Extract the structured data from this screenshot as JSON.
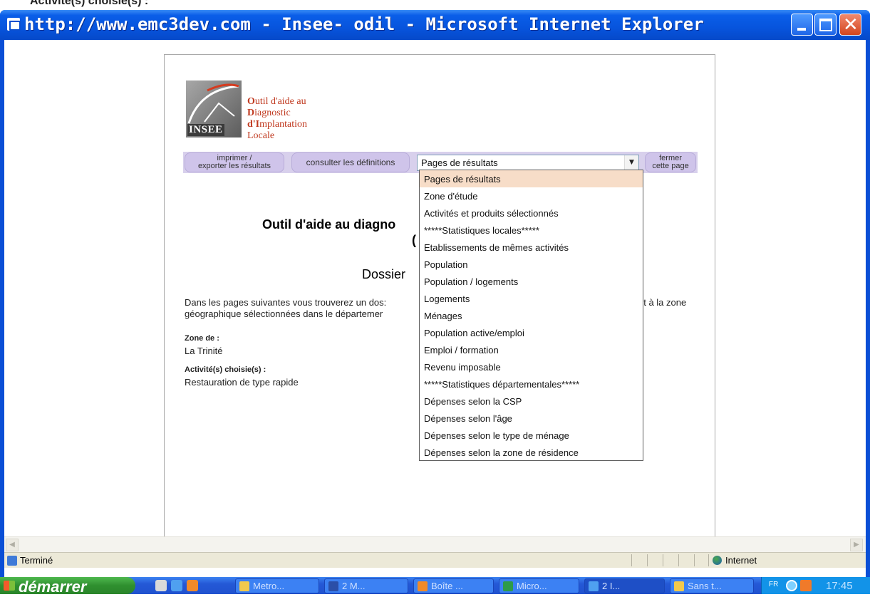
{
  "clipped_top_text": "Activité(s) choisie(s) :",
  "window": {
    "title": "http://www.emc3dev.com - Insee- odil - Microsoft Internet Explorer"
  },
  "logo": {
    "insee": "INSEE",
    "lines": [
      {
        "initial": "O",
        "rest": "util d'aide au"
      },
      {
        "initial": "D",
        "rest": "iagnostic"
      },
      {
        "initial": "d'I",
        "rest": "mplantation"
      },
      {
        "initial": "",
        "rest": "Locale"
      }
    ]
  },
  "toolbar": {
    "print_line1": "imprimer /",
    "print_line2": "exporter les résultats",
    "definitions": "consulter les définitions",
    "select_value": "Pages de résultats",
    "close_line1": "fermer",
    "close_line2": "cette page"
  },
  "content": {
    "title_part": "Outil d'aide au diagno",
    "title_part2": "(",
    "dossier": "Dossier",
    "intro_line1": "Dans les pages suivantes vous trouverez un dos:",
    "intro_line1_end": "et à la zone",
    "intro_line2": "géographique sélectionnées dans le départemer",
    "zone_label": "Zone de :",
    "zone_value": "La Trinité",
    "activity_label": "Activité(s) choisie(s) :",
    "activity_value": "Restauration de type rapide"
  },
  "dropdown": {
    "selected_index": 0,
    "options": [
      "Pages de résultats",
      "Zone d'étude",
      "Activités et produits sélectionnés",
      "*****Statistiques locales*****",
      "Etablissements de mêmes activités",
      "Population",
      "Population / logements",
      "Logements",
      "Ménages",
      "Population active/emploi",
      "Emploi / formation",
      "Revenu imposable",
      "*****Statistiques départementales*****",
      "Dépenses selon la CSP",
      "Dépenses selon l'âge",
      "Dépenses selon le type de ménage",
      "Dépenses selon la zone de résidence"
    ]
  },
  "statusbar": {
    "status": "Terminé",
    "zone": "Internet"
  },
  "taskbar": {
    "start": "démarrer",
    "tasks": [
      "Metro...",
      "2 M...",
      "Boîte ...",
      "Micro...",
      "2 I...",
      "Sans t..."
    ],
    "lang": "FR",
    "clock": "17:45"
  },
  "colors": {
    "title_bar": "#0754dd",
    "toolbar_bg": "#d8d0ec",
    "logo_red": "#c0391f",
    "dropdown_selected": "#f7ddc8"
  }
}
